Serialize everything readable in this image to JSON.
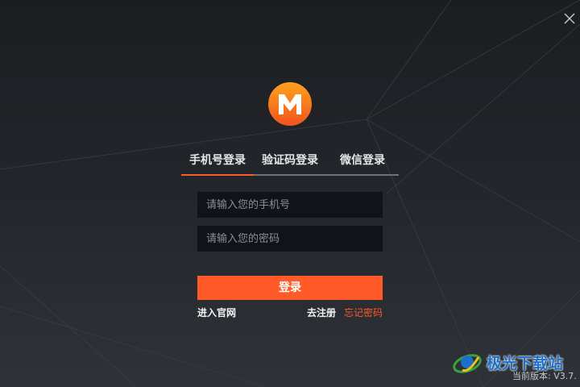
{
  "window": {
    "close_icon": "close-icon"
  },
  "logo": {
    "letter": "M",
    "brand_color": "#f7741c"
  },
  "tabs": [
    {
      "label": "手机号登录",
      "active": true
    },
    {
      "label": "验证码登录",
      "active": false
    },
    {
      "label": "微信登录",
      "active": false
    }
  ],
  "form": {
    "phone_placeholder": "请输入您的手机号",
    "password_placeholder": "请输入您的密码",
    "login_label": "登录"
  },
  "links": {
    "official_site": "进入官网",
    "register": "去注册",
    "forgot_password": "忘记密码"
  },
  "watermark": {
    "text": "极光下载站"
  },
  "version_text": "当前版本: V3.7.",
  "colors": {
    "accent": "#ff5a28",
    "field_bg": "#111318"
  }
}
